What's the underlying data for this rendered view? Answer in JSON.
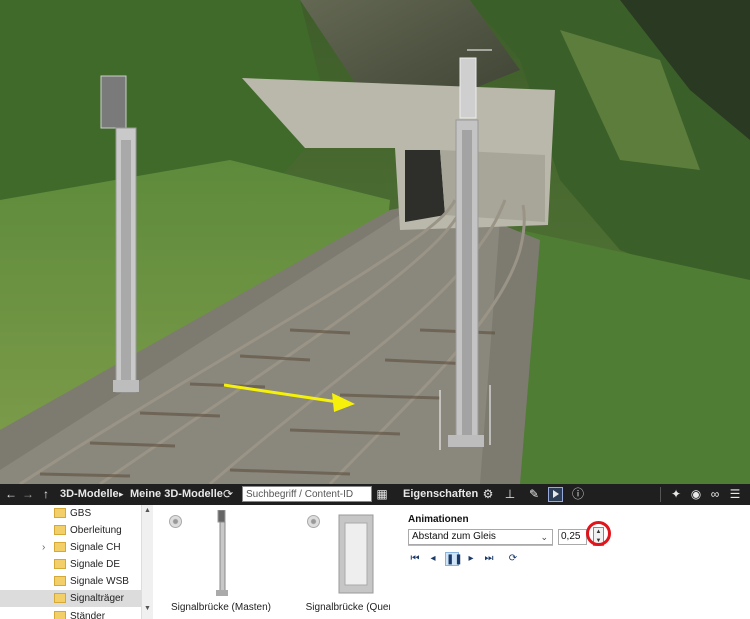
{
  "toolbar": {
    "back_icon": "arrow-left-icon",
    "forward_icon": "arrow-right-icon",
    "up_icon": "arrow-up-icon",
    "breadcrumb_root": "3D-Modelle",
    "breadcrumb_separator": "▸",
    "breadcrumb_current": "Meine 3D-Modelle",
    "refresh_icon": "refresh-icon",
    "search_placeholder": "Suchbegriff / Content-ID",
    "grid_icon": "grid-view-icon",
    "properties_title": "Eigenschaften",
    "property_tabs": [
      "gear-icon",
      "axes-icon",
      "brush-icon",
      "play-icon",
      "info-icon"
    ],
    "right_icons": [
      "pin-icon",
      "eye-icon",
      "link-icon",
      "menu-icon"
    ]
  },
  "folders": {
    "items": [
      {
        "label": "GBS",
        "expandable": false,
        "selected": false
      },
      {
        "label": "Oberleitung",
        "expandable": false,
        "selected": false
      },
      {
        "label": "Signale CH",
        "expandable": true,
        "selected": false
      },
      {
        "label": "Signale DE",
        "expandable": false,
        "selected": false
      },
      {
        "label": "Signale WSB",
        "expandable": false,
        "selected": false
      },
      {
        "label": "Signalträger",
        "expandable": false,
        "selected": true
      },
      {
        "label": "Ständer",
        "expandable": false,
        "selected": false
      }
    ]
  },
  "models": {
    "items": [
      {
        "label": "Signalbrücke (Masten)"
      },
      {
        "label": "Signalbrücke (Quergurt)"
      }
    ]
  },
  "properties": {
    "section_title": "Animationen",
    "animation_select": "Abstand zum Gleis",
    "animation_value": "0,25",
    "playback": [
      "skip-start-icon",
      "step-back-icon",
      "pause-icon",
      "step-forward-icon",
      "skip-end-icon",
      "loop-icon"
    ],
    "highlight_color": "#e0141a"
  },
  "viewport": {
    "scene": "3d-railway-scene",
    "arrow_color": "#f5f10a"
  }
}
